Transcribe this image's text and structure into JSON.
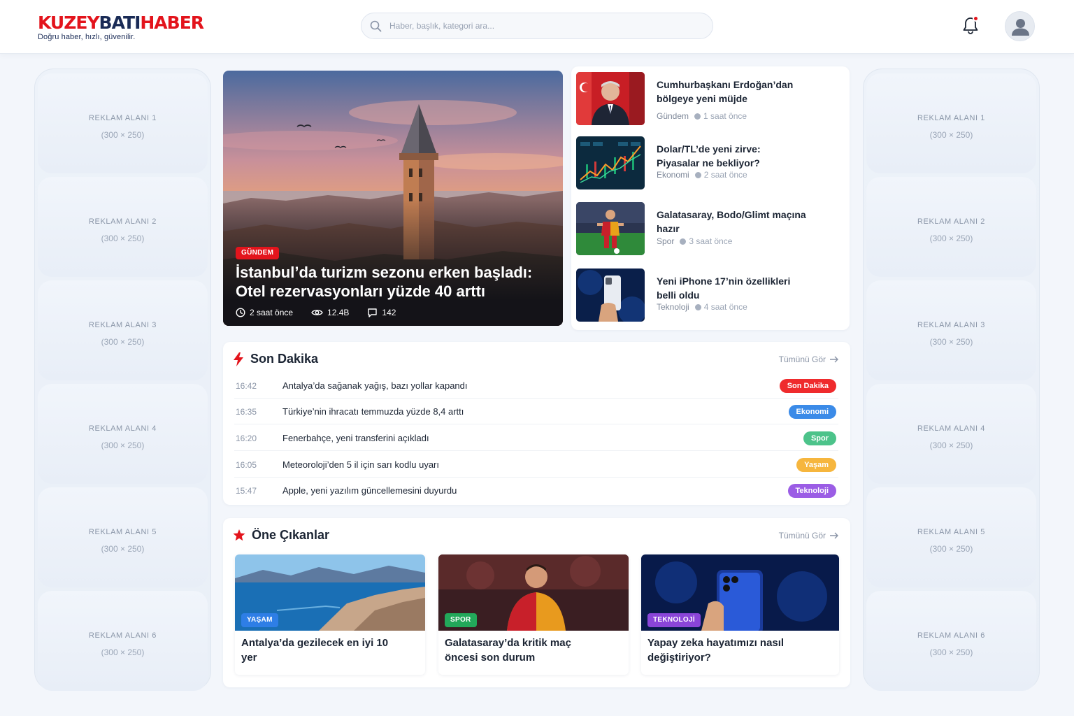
{
  "header": {
    "logo": {
      "part1": "KUZEY",
      "part2": "BATI",
      "part3": "HABER",
      "tagline": "Doğru haber, hızlı, güvenilir."
    },
    "search_placeholder": "Haber, başlık, kategori ara...",
    "icons": {
      "search": "search-icon",
      "notifications": "bell-icon",
      "profile": "user-icon"
    }
  },
  "ads": {
    "left": [
      {
        "label": "REKLAM ALANI 1",
        "size": "(300 × 250)"
      },
      {
        "label": "REKLAM ALANI 2",
        "size": "(300 × 250)"
      },
      {
        "label": "REKLAM ALANI 3",
        "size": "(300 × 250)"
      },
      {
        "label": "REKLAM ALANI 4",
        "size": "(300 × 250)"
      },
      {
        "label": "REKLAM ALANI 5",
        "size": "(300 × 250)"
      },
      {
        "label": "REKLAM ALANI 6",
        "size": "(300 × 250)"
      }
    ],
    "right": [
      {
        "label": "REKLAM ALANI 1",
        "size": "(300 × 250)"
      },
      {
        "label": "REKLAM ALANI 2",
        "size": "(300 × 250)"
      },
      {
        "label": "REKLAM ALANI 3",
        "size": "(300 × 250)"
      },
      {
        "label": "REKLAM ALANI 4",
        "size": "(300 × 250)"
      },
      {
        "label": "REKLAM ALANI 5",
        "size": "(300 × 250)"
      },
      {
        "label": "REKLAM ALANI 6",
        "size": "(300 × 250)"
      }
    ]
  },
  "hero": {
    "category": "GÜNDEM",
    "title_line1": "İstanbul’da turizm sezonu erken başladı:",
    "title_line2": "Otel rezervasyonları yüzde 40 arttı",
    "time": "2 saat önce",
    "views": "12.4B",
    "comments": "142"
  },
  "side_news": [
    {
      "title_line1": "Cumhurbaşkanı Erdoğan’dan",
      "title_line2": "bölgeye yeni müjde",
      "category": "Gündem",
      "time": "1 saat önce"
    },
    {
      "title_line1": "Dolar/TL’de yeni zirve:",
      "title_line2": "Piyasalar ne bekliyor?",
      "category": "Ekonomi",
      "time": "2 saat önce"
    },
    {
      "title_line1": "Galatasaray, Bodo/Glimt maçına",
      "title_line2": "hazır",
      "category": "Spor",
      "time": "3 saat önce"
    },
    {
      "title_line1": "Yeni iPhone 17’nin özellikleri",
      "title_line2": "belli oldu",
      "category": "Teknoloji",
      "time": "4 saat önce"
    }
  ],
  "breaking": {
    "title": "Son Dakika",
    "see_all": "Tümünü Gör",
    "items": [
      {
        "time": "16:42",
        "text": "Antalya’da sağanak yağış, bazı yollar kapandı",
        "tag": "Son Dakika",
        "color": "#ef2b2d"
      },
      {
        "time": "16:35",
        "text": "Türkiye’nin ihracatı temmuzda yüzde 8,4 arttı",
        "tag": "Ekonomi",
        "color": "#3b8be8"
      },
      {
        "time": "16:20",
        "text": "Fenerbahçe, yeni transferini açıkladı",
        "tag": "Spor",
        "color": "#4cc38a"
      },
      {
        "time": "16:05",
        "text": "Meteoroloji’den 5 il için sarı kodlu uyarı",
        "tag": "Yaşam",
        "color": "#f6b63e"
      },
      {
        "time": "15:47",
        "text": "Apple, yeni yazılım güncellemesini duyurdu",
        "tag": "Teknoloji",
        "color": "#9b5de5"
      }
    ]
  },
  "featured": {
    "title": "Öne Çıkanlar",
    "see_all": "Tümünü Gör",
    "cards": [
      {
        "tag": "YAŞAM",
        "color": "#2e7ee6",
        "title_line1": "Antalya’da gezilecek en iyi 10",
        "title_line2": "yer"
      },
      {
        "tag": "SPOR",
        "color": "#22a85a",
        "title_line1": "Galatasaray’da kritik maç",
        "title_line2": "öncesi son durum"
      },
      {
        "tag": "TEKNOLOJİ",
        "color": "#8a45d8",
        "title_line1": "Yapay zeka hayatımızı nasıl",
        "title_line2": "değiştiriyor?"
      }
    ]
  },
  "colors": {
    "brand_red": "#e3141c",
    "brand_navy": "#1a2b56",
    "background": "#f3f6fb"
  }
}
